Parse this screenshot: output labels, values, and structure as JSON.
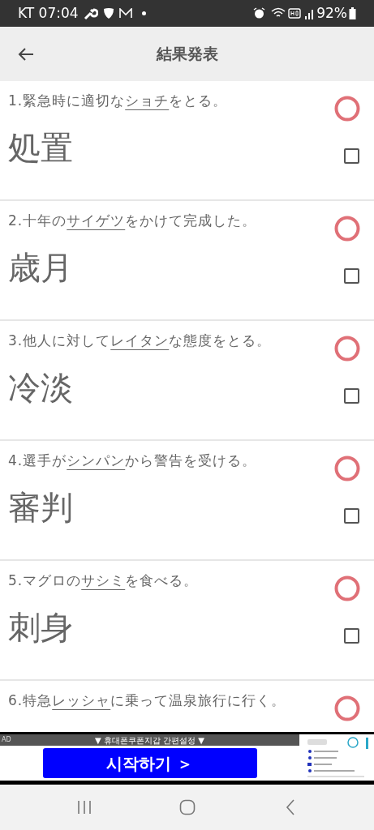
{
  "status_bar": {
    "carrier_time": "KT 07:04",
    "battery": "92%"
  },
  "header": {
    "title": "結果発表"
  },
  "questions": [
    {
      "before": "1.緊急時に適切な",
      "target": "ショチ",
      "after": "をとる。",
      "answer": "処置",
      "correct": true,
      "checked": false
    },
    {
      "before": "2.十年の",
      "target": "サイゲツ",
      "after": "をかけて完成した。",
      "answer": "歳月",
      "correct": true,
      "checked": false
    },
    {
      "before": "3.他人に対して",
      "target": "レイタン",
      "after": "な態度をとる。",
      "answer": "冷淡",
      "correct": true,
      "checked": false
    },
    {
      "before": "4.選手が",
      "target": "シンパン",
      "after": "から警告を受ける。",
      "answer": "審判",
      "correct": true,
      "checked": false
    },
    {
      "before": "5.マグロの",
      "target": "サシミ",
      "after": "を食べる。",
      "answer": "刺身",
      "correct": true,
      "checked": false
    },
    {
      "before": "6.特急",
      "target": "レッシャ",
      "after": "に乗って温泉旅行に行く。",
      "correct": true
    }
  ],
  "ad": {
    "label": "AD",
    "banner": "▼ 휴대폰쿠폰지갑 간편설정 ▼",
    "button": "시작하기 ＞"
  }
}
